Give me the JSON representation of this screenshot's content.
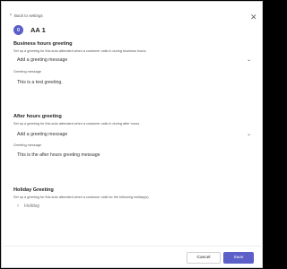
{
  "nav": {
    "back_label": "Back to settings"
  },
  "header": {
    "title": "AA 1",
    "avatar_initial": "0"
  },
  "business": {
    "title": "Business hours greeting",
    "description": "Set up a greeting for this auto attendant when a customer calls in during business hours.",
    "dropdown_value": "Add a greeting message",
    "message_label": "Greeting message",
    "message_value": "This is a test greeting."
  },
  "after_hours": {
    "title": "After hours greeting",
    "description": "Set up a greeting for this auto attendant when a customer calls in during after hours.",
    "dropdown_value": "Add a greeting message",
    "message_label": "Greeting message",
    "message_value": "This is the after hours greeting message"
  },
  "holiday": {
    "title": "Holiday Greeting",
    "description": "Set up a greeting for this auto attendant when a customer calls for the following holiday(s).",
    "item_label": "Holiday"
  },
  "footer": {
    "cancel_label": "Cancel",
    "save_label": "Save"
  },
  "colors": {
    "accent": "#5b5fc7"
  }
}
